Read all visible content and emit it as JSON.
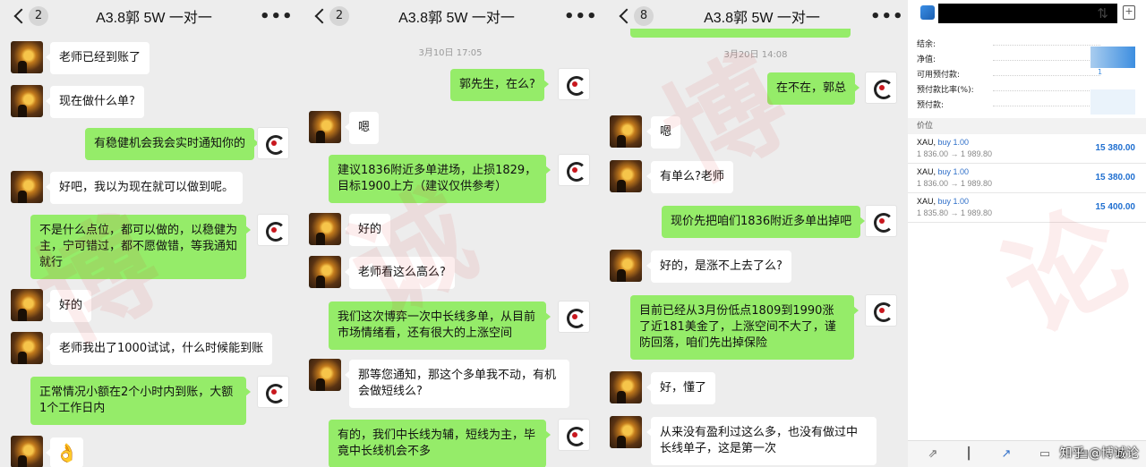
{
  "panels": [
    {
      "badge": "2",
      "title": "A3.8郭 5W 一对一",
      "timestamp": ""
    },
    {
      "badge": "2",
      "title": "A3.8郭 5W 一对一",
      "timestamp": "3月10日 17:05"
    },
    {
      "badge": "8",
      "title": "A3.8郭 5W 一对一",
      "timestamp": "3月20日 14:08"
    }
  ],
  "chat1": [
    {
      "dir": "in",
      "text": "老师已经到账了"
    },
    {
      "dir": "in",
      "text": "现在做什么单?"
    },
    {
      "dir": "out",
      "text": "有稳健机会我会实时通知你的"
    },
    {
      "dir": "in",
      "text": "好吧，我以为现在就可以做到呢。"
    },
    {
      "dir": "out",
      "text": "不是什么点位，都可以做的，以稳健为主，宁可错过，都不愿做错，等我通知就行"
    },
    {
      "dir": "in",
      "text": "好的"
    },
    {
      "dir": "in",
      "text": "老师我出了1000试试，什么时候能到账"
    },
    {
      "dir": "out",
      "text": "正常情况小额在2个小时内到账，大额1个工作日内"
    },
    {
      "dir": "in",
      "text": "👌"
    }
  ],
  "chat2": [
    {
      "dir": "out",
      "text": "郭先生，在么?"
    },
    {
      "dir": "in",
      "text": "嗯"
    },
    {
      "dir": "out",
      "text": "建议1836附近多单进场，止损1829，目标1900上方（建议仅供参考）"
    },
    {
      "dir": "in",
      "text": "好的"
    },
    {
      "dir": "in",
      "text": "老师看这么高么?"
    },
    {
      "dir": "out",
      "text": "我们这次博弈一次中长线多单，从目前市场情绪看，还有很大的上涨空间"
    },
    {
      "dir": "in",
      "text": "那等您通知，那这个多单我不动，有机会做短线么?"
    },
    {
      "dir": "out",
      "text": "有的，我们中长线为辅，短线为主，毕竟中长线机会不多"
    }
  ],
  "chat3": [
    {
      "dir": "out",
      "text": "在不在，郭总"
    },
    {
      "dir": "in",
      "text": "嗯"
    },
    {
      "dir": "in",
      "text": "有单么?老师"
    },
    {
      "dir": "out",
      "text": "现价先把咱们1836附近多单出掉吧"
    },
    {
      "dir": "in",
      "text": "好的，是涨不上去了么?"
    },
    {
      "dir": "out",
      "text": "目前已经从3月份低点1809到1990涨了近181美金了，上涨空间不大了，谨防回落，咱们先出掉保险"
    },
    {
      "dir": "in",
      "text": "好，懂了"
    },
    {
      "dir": "in",
      "text": "从来没有盈利过这么多，也没有做过中长线单子，这是第一次"
    }
  ],
  "trading": {
    "account_labels": [
      "结余:",
      "净值:",
      "可用预付款:",
      "预付款比率(%):",
      "预付款:"
    ],
    "free_margin_hint": "1",
    "section_label": "价位",
    "positions": [
      {
        "symbol": "XAU,",
        "direction": "buy 1.00",
        "prices": "1 836.00 → 1 989.80",
        "profit": "15 380.00"
      },
      {
        "symbol": "XAU,",
        "direction": "buy 1.00",
        "prices": "1 836.00 → 1 989.80",
        "profit": "15 380.00"
      },
      {
        "symbol": "XAU,",
        "direction": "buy 1.00",
        "prices": "1 835.80 → 1 989.80",
        "profit": "15 400.00"
      }
    ]
  },
  "zhihu": "知乎 @博诚论",
  "watermark_chars": [
    "博",
    "诚",
    "论"
  ]
}
